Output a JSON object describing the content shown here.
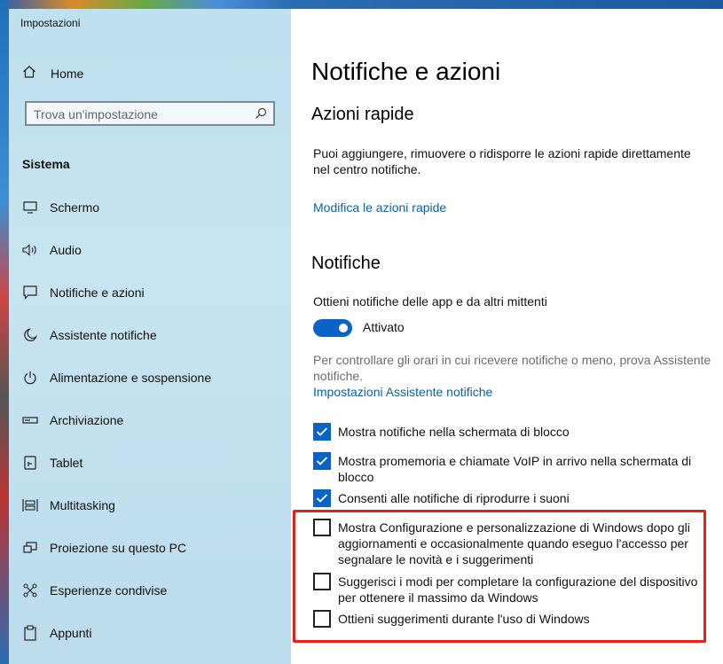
{
  "window": {
    "title": "Impostazioni"
  },
  "sidebar": {
    "home_label": "Home",
    "search_placeholder": "Trova un'impostazione",
    "section_label": "Sistema",
    "items": [
      {
        "label": "Schermo",
        "icon": "monitor-icon"
      },
      {
        "label": "Audio",
        "icon": "speaker-icon"
      },
      {
        "label": "Notifiche e azioni",
        "icon": "notification-icon"
      },
      {
        "label": "Assistente notifiche",
        "icon": "moon-icon"
      },
      {
        "label": "Alimentazione e sospensione",
        "icon": "power-icon"
      },
      {
        "label": "Archiviazione",
        "icon": "storage-icon"
      },
      {
        "label": "Tablet",
        "icon": "tablet-icon"
      },
      {
        "label": "Multitasking",
        "icon": "multitasking-icon"
      },
      {
        "label": "Proiezione su questo PC",
        "icon": "projection-icon"
      },
      {
        "label": "Esperienze condivise",
        "icon": "shared-icon"
      },
      {
        "label": "Appunti",
        "icon": "clipboard-icon"
      }
    ]
  },
  "main": {
    "page_title": "Notifiche e azioni",
    "quick_actions": {
      "heading": "Azioni rapide",
      "description": "Puoi aggiungere, rimuovere o ridisporre le azioni rapide direttamente nel centro notifiche.",
      "link": "Modifica le azioni rapide"
    },
    "notifications": {
      "heading": "Notifiche",
      "get_label": "Ottieni notifiche delle app e da altri mittenti",
      "toggle_state": "Attivato",
      "toggle_on": true,
      "hint": "Per controllare gli orari in cui ricevere notifiche o meno, prova Assistente notifiche.",
      "hint_link": "Impostazioni Assistente notifiche",
      "checkboxes": [
        {
          "label": "Mostra notifiche nella schermata di blocco",
          "checked": true
        },
        {
          "label": "Mostra promemoria e chiamate VoIP in arrivo nella schermata di blocco",
          "checked": true
        },
        {
          "label": "Consenti alle notifiche di riprodurre i suoni",
          "checked": true
        },
        {
          "label": "Mostra Configurazione e personalizzazione di Windows dopo gli aggiornamenti e occasionalmente quando eseguo l'accesso per segnalare le novità e i suggerimenti",
          "checked": false
        },
        {
          "label": "Suggerisci i modi per completare la configurazione del dispositivo per ottenere il massimo da Windows",
          "checked": false
        },
        {
          "label": "Ottieni suggerimenti durante l'uso di Windows",
          "checked": false
        }
      ]
    }
  },
  "colors": {
    "accent": "#0a64c8",
    "link": "#0b62a4",
    "highlight_box": "#e2231a",
    "sidebar_bg": "#c3e1ef"
  }
}
